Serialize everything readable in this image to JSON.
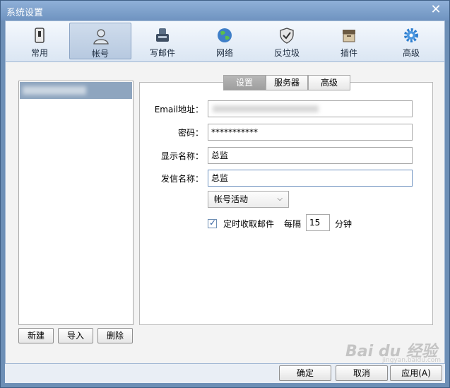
{
  "window": {
    "title": "系统设置"
  },
  "toolbar": {
    "items": [
      {
        "label": "常用",
        "icon": "switch-icon"
      },
      {
        "label": "帐号",
        "icon": "user-icon"
      },
      {
        "label": "写邮件",
        "icon": "compose-icon"
      },
      {
        "label": "网络",
        "icon": "globe-icon"
      },
      {
        "label": "反垃圾",
        "icon": "shield-icon"
      },
      {
        "label": "插件",
        "icon": "box-icon"
      },
      {
        "label": "高级",
        "icon": "gear-icon"
      }
    ],
    "active": "帐号"
  },
  "accounts": {
    "buttons": {
      "new": "新建",
      "import": "导入",
      "delete": "删除"
    }
  },
  "tabs": {
    "settings": "设置",
    "server": "服务器",
    "advanced": "高级",
    "active": "设置"
  },
  "form": {
    "email_label": "Email地址：",
    "password_label": "密码：",
    "password_value": "***********",
    "display_name_label": "显示名称：",
    "display_name_value": "总监",
    "sender_name_label": "发信名称：",
    "sender_name_value": "总监",
    "status_dropdown": "帐号活动",
    "auto_fetch_label": "定时收取邮件",
    "auto_fetch_checked": true,
    "every_label": "每隔",
    "interval_value": "15",
    "minutes_label": "分钟"
  },
  "footer": {
    "ok": "确定",
    "cancel": "取消",
    "apply": "应用(A)"
  },
  "watermark": {
    "logo": "Bai du 经验",
    "url": "jingyan.baidu.com"
  },
  "colors": {
    "title_bar": "#7396c2",
    "active_tool": "#b7c9e0",
    "selected_account": "#8ea5bf"
  }
}
